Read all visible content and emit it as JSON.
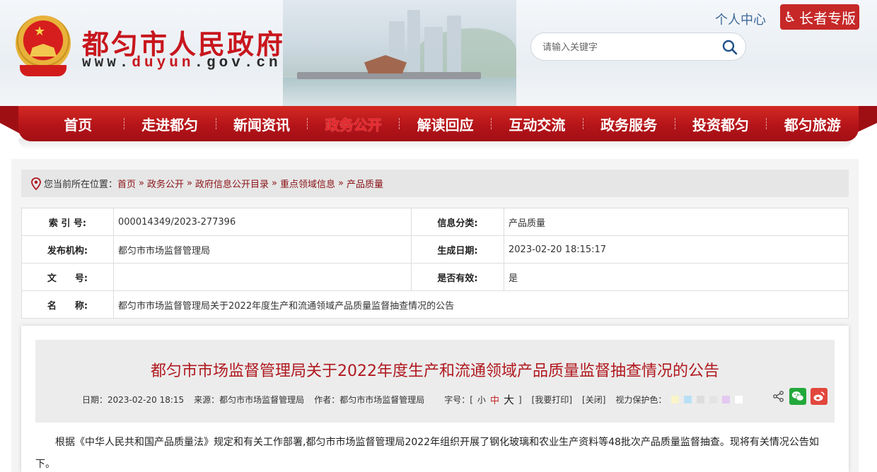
{
  "header": {
    "site_title": "都匀市人民政府",
    "url_prefix": "www.",
    "url_highlight": "duyun",
    "url_suffix": ".gov.cn",
    "user_center": "个人中心",
    "elder_version": "长者专版",
    "search_placeholder": "请输入关键字"
  },
  "nav": {
    "items": [
      {
        "label": "首页"
      },
      {
        "label": "走进都匀"
      },
      {
        "label": "新闻资讯"
      },
      {
        "label": "政务公开",
        "active": true
      },
      {
        "label": "解读回应"
      },
      {
        "label": "互动交流"
      },
      {
        "label": "政务服务"
      },
      {
        "label": "投资都匀"
      },
      {
        "label": "都匀旅游"
      }
    ]
  },
  "breadcrumb": {
    "prefix": "您当前所在位置：",
    "items": [
      "首页",
      "政务公开",
      "政府信息公开目录",
      "重点领域信息",
      "产品质量"
    ],
    "separator": "»"
  },
  "meta": {
    "index_label": "索 引 号:",
    "index_value": "000014349/2023-277396",
    "category_label": "信息分类:",
    "category_value": "产品质量",
    "publisher_label": "发布机构:",
    "publisher_value": "都匀市市场监督管理局",
    "date_label": "生成日期:",
    "date_value": "2023-02-20 18:15:17",
    "docno_label": "文　　号:",
    "docno_value": "",
    "valid_label": "是否有效:",
    "valid_value": "是",
    "name_label": "名　　称:",
    "name_value": "都匀市市场监督管理局关于2022年度生产和流通领域产品质量监督抽查情况的公告"
  },
  "article": {
    "title": "都匀市市场监督管理局关于2022年度生产和流通领域产品质量监督抽查情况的公告",
    "date_label": "日期：",
    "date": "2023-02-20 18:15",
    "source_label": "来源：",
    "source": "都匀市市场监督管理局",
    "author_label": "作者：",
    "author": "都匀市市场监督管理局",
    "font_label": "字号：",
    "bracket_open": "[",
    "bracket_close": "]",
    "font_small": "小",
    "font_medium": "中",
    "font_large": "大",
    "print": "[我要打印]",
    "close": "[关闭]",
    "eye_care_label": "视力保护色：",
    "eye_colors": [
      "#faf5c8",
      "#b9e0f5",
      "#dddddd",
      "#e4e4e4",
      "#e3c9f1",
      "#ffffff"
    ],
    "paragraph": "根据《中华人民共和国产品质量法》规定和有关工作部署,都匀市市场监督管理局2022年组织开展了钢化玻璃和农业生产资料等48批次产品质量监督抽查。现将有关情况公告如下。"
  },
  "colors": {
    "brand_red": "#c8161d",
    "nav_red": "#b5141a",
    "title_red": "#b0191f",
    "link_blue": "#3d6a9a",
    "wechat_green": "#23a83b",
    "weibo_red": "#e2473d"
  }
}
